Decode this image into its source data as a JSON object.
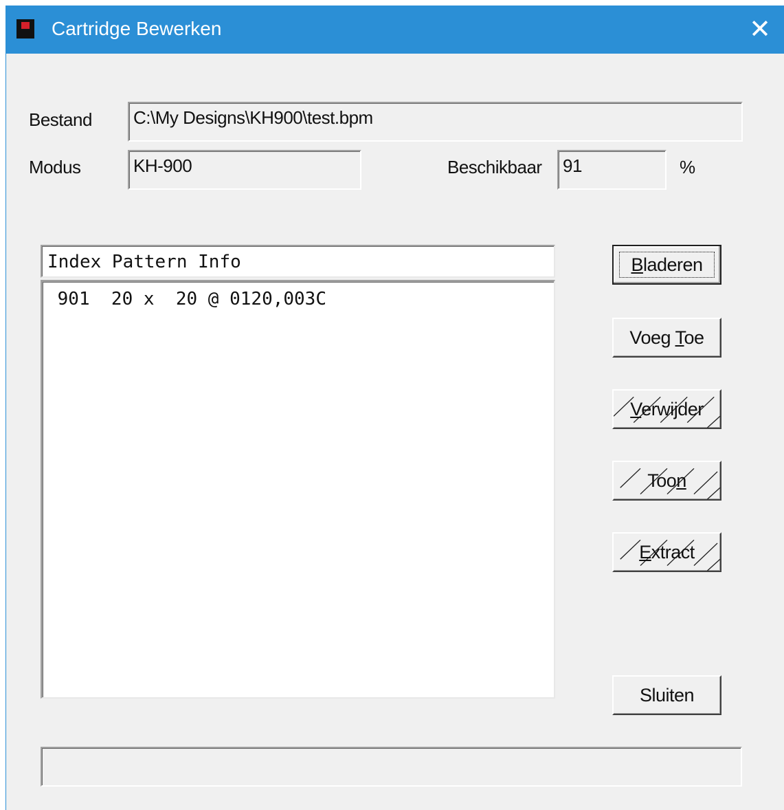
{
  "window": {
    "title": "Cartridge Bewerken",
    "close_glyph": "✕",
    "icon": "app-icon"
  },
  "form": {
    "bestand_label": "Bestand",
    "bestand_value": "C:\\My Designs\\KH900\\test.bpm",
    "modus_label": "Modus",
    "modus_value": "KH-900",
    "beschikbaar_label": "Beschikbaar",
    "beschikbaar_value": "91",
    "percent_label": "%"
  },
  "list": {
    "header": "Index Pattern Info",
    "items": [
      " 901  20 x  20 @ 0120,003C"
    ]
  },
  "buttons": {
    "bladeren": {
      "pre": "",
      "accel": "B",
      "post": "laderen"
    },
    "voeg_toe": {
      "pre": "Voeg ",
      "accel": "T",
      "post": "oe"
    },
    "verwijder": {
      "pre": "",
      "accel": "V",
      "post": "erwijder"
    },
    "toon": {
      "pre": "Too",
      "accel": "n",
      "post": ""
    },
    "extract": {
      "pre": "",
      "accel": "E",
      "post": "xtract"
    },
    "sluiten": "Sluiten"
  },
  "status_text": "",
  "colors": {
    "titlebar": "#2b8fd6",
    "face": "#f0f0f0"
  }
}
